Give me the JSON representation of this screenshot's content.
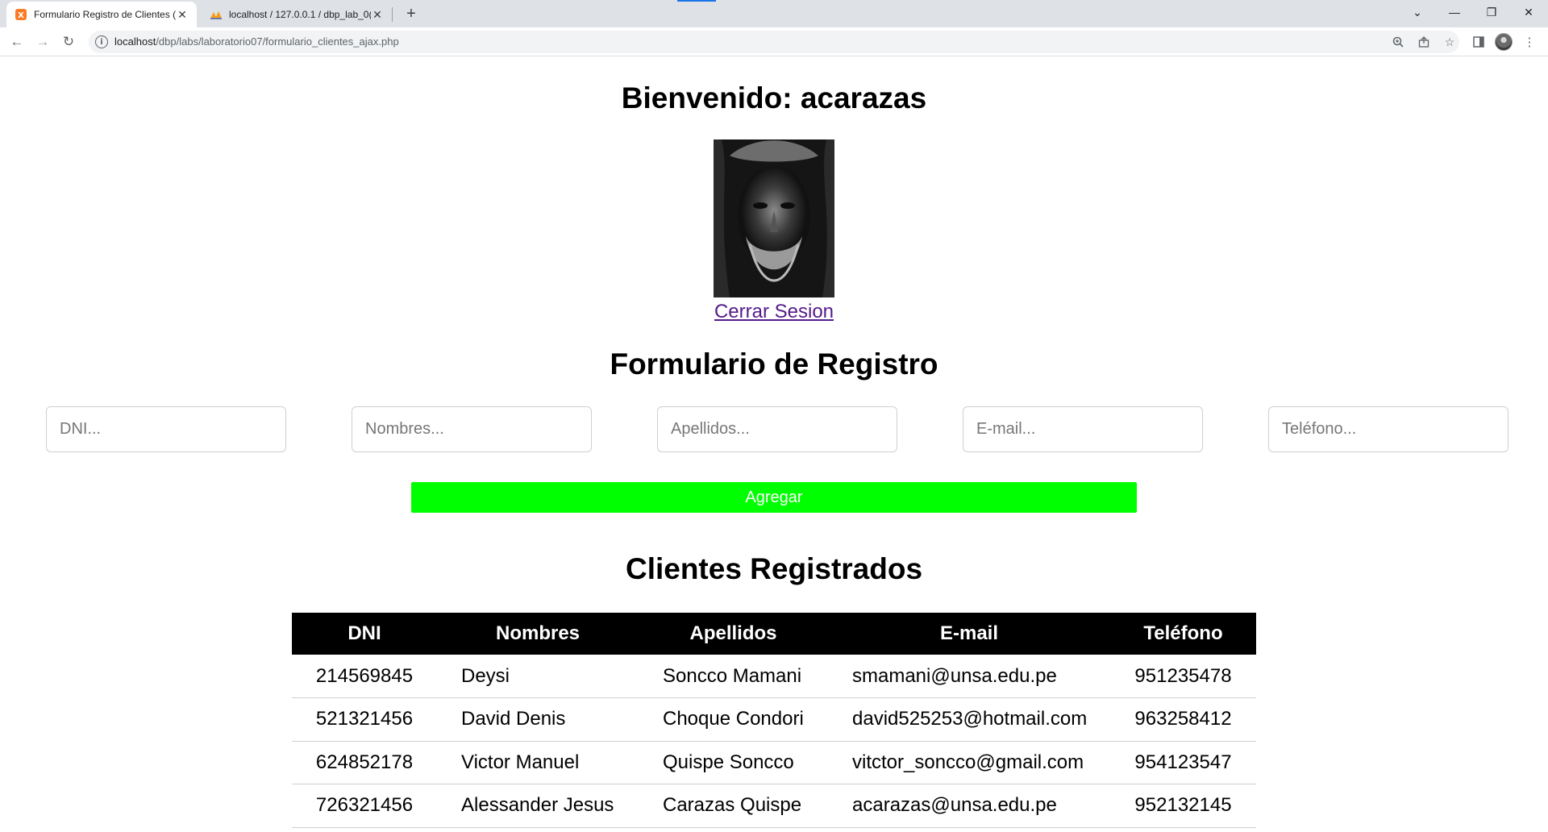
{
  "browser": {
    "tabs": [
      {
        "title": "Formulario Registro de Clientes (A",
        "favicon": "xampp-icon",
        "active": true
      },
      {
        "title": "localhost / 127.0.0.1 / dbp_lab_0(",
        "favicon": "phpmyadmin-icon",
        "active": false
      }
    ],
    "url_host": "localhost",
    "url_path": "/dbp/labs/laboratorio07/formulario_clientes_ajax.php"
  },
  "page": {
    "welcome": "Bienvenido: acarazas",
    "logout_label": "Cerrar Sesion",
    "form_title": "Formulario de Registro",
    "fields": {
      "dni_placeholder": "DNI...",
      "nombres_placeholder": "Nombres...",
      "apellidos_placeholder": "Apellidos...",
      "email_placeholder": "E-mail...",
      "telefono_placeholder": "Teléfono..."
    },
    "add_button": "Agregar",
    "add_button_color": "#00ff00",
    "clients_title": "Clientes Registrados",
    "table": {
      "headers": [
        "DNI",
        "Nombres",
        "Apellidos",
        "E-mail",
        "Teléfono"
      ],
      "rows": [
        [
          "214569845",
          "Deysi",
          "Soncco Mamani",
          "smamani@unsa.edu.pe",
          "951235478"
        ],
        [
          "521321456",
          "David Denis",
          "Choque Condori",
          "david525253@hotmail.com",
          "963258412"
        ],
        [
          "624852178",
          "Victor Manuel",
          "Quispe Soncco",
          "vitctor_soncco@gmail.com",
          "954123547"
        ],
        [
          "726321456",
          "Alessander Jesus",
          "Carazas Quispe",
          "acarazas@unsa.edu.pe",
          "952132145"
        ]
      ]
    }
  }
}
